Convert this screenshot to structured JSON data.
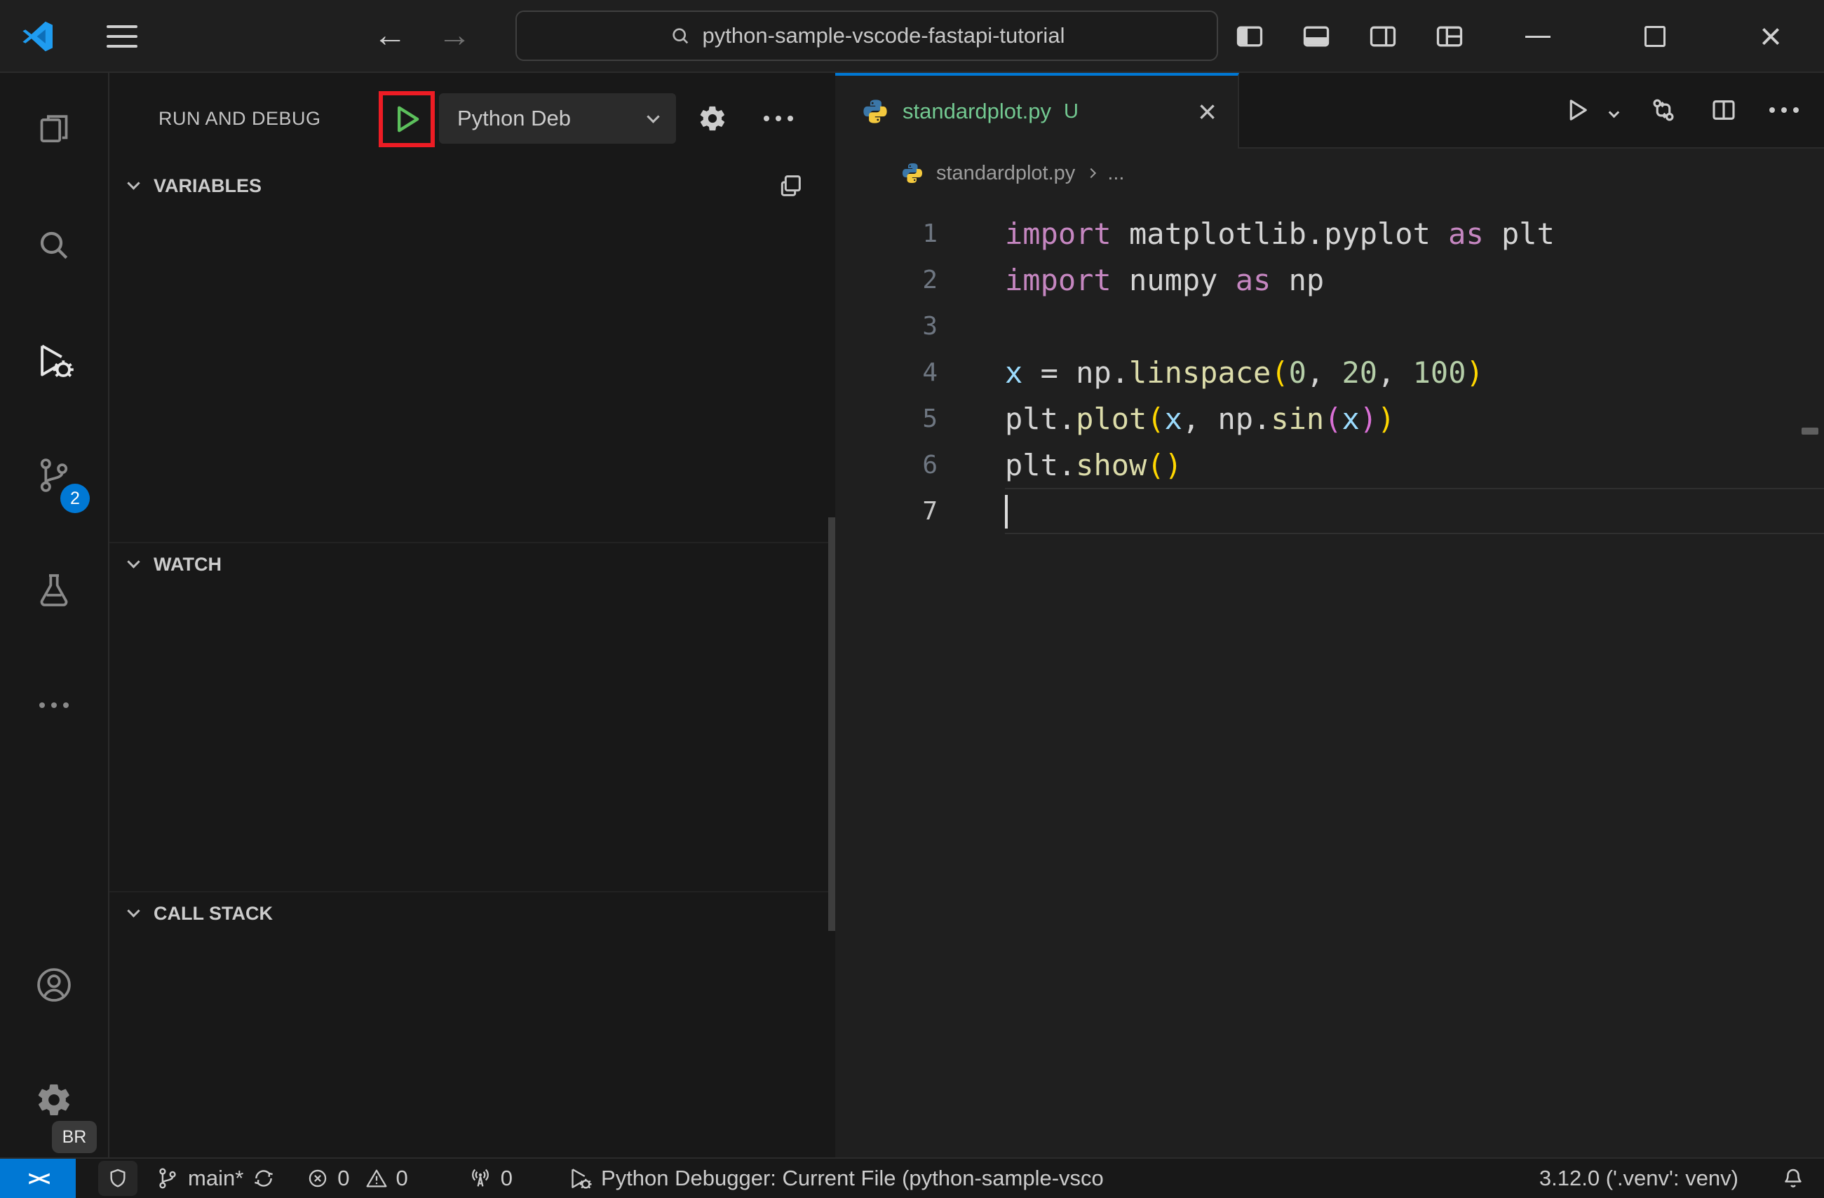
{
  "colors": {
    "accent": "#0078d4",
    "annotation-red": "#ed1c24",
    "debug-green": "#5cc05c",
    "untracked-green": "#73c991",
    "badge-blue": "#0078d4"
  },
  "glyphs": {
    "back_arrow": "←",
    "forward_arrow": "→",
    "close_x": "×"
  },
  "title_bar": {
    "search_value": "python-sample-vscode-fastapi-tutorial"
  },
  "activity_bar": {
    "source_control_badge": "2",
    "profile_badge": "BR"
  },
  "sidebar": {
    "title": "RUN AND DEBUG",
    "debug_config": "Python Deb",
    "sections": [
      {
        "label": "VARIABLES"
      },
      {
        "label": "WATCH"
      },
      {
        "label": "CALL STACK"
      }
    ]
  },
  "editor": {
    "tab": {
      "label": "standardplot.py",
      "git_status": "U"
    },
    "breadcrumb": {
      "file": "standardplot.py",
      "symbol": "..."
    },
    "lines": [
      {
        "num": "1",
        "tokens": [
          {
            "t": "import",
            "c": "kw"
          },
          {
            "t": " matplotlib.pyplot ",
            "c": "plain"
          },
          {
            "t": "as",
            "c": "kw"
          },
          {
            "t": " plt",
            "c": "plain"
          }
        ]
      },
      {
        "num": "2",
        "tokens": [
          {
            "t": "import",
            "c": "kw"
          },
          {
            "t": " numpy ",
            "c": "plain"
          },
          {
            "t": "as",
            "c": "kw"
          },
          {
            "t": " np",
            "c": "plain"
          }
        ]
      },
      {
        "num": "3",
        "tokens": []
      },
      {
        "num": "4",
        "tokens": [
          {
            "t": "x",
            "c": "var"
          },
          {
            "t": " = ",
            "c": "plain"
          },
          {
            "t": "np.",
            "c": "plain"
          },
          {
            "t": "linspace",
            "c": "fn"
          },
          {
            "t": "(",
            "c": "br1"
          },
          {
            "t": "0",
            "c": "num"
          },
          {
            "t": ", ",
            "c": "plain"
          },
          {
            "t": "20",
            "c": "num"
          },
          {
            "t": ", ",
            "c": "plain"
          },
          {
            "t": "100",
            "c": "num"
          },
          {
            "t": ")",
            "c": "br1"
          }
        ]
      },
      {
        "num": "5",
        "tokens": [
          {
            "t": "plt.",
            "c": "plain"
          },
          {
            "t": "plot",
            "c": "fn"
          },
          {
            "t": "(",
            "c": "br1"
          },
          {
            "t": "x",
            "c": "var"
          },
          {
            "t": ", ",
            "c": "plain"
          },
          {
            "t": "np.",
            "c": "plain"
          },
          {
            "t": "sin",
            "c": "fn"
          },
          {
            "t": "(",
            "c": "br2"
          },
          {
            "t": "x",
            "c": "var"
          },
          {
            "t": ")",
            "c": "br2"
          },
          {
            "t": ")",
            "c": "br1"
          }
        ]
      },
      {
        "num": "6",
        "tokens": [
          {
            "t": "plt.",
            "c": "plain"
          },
          {
            "t": "show",
            "c": "fn"
          },
          {
            "t": "(",
            "c": "br1"
          },
          {
            "t": ")",
            "c": "br1"
          }
        ]
      },
      {
        "num": "7",
        "tokens": [],
        "active": true,
        "cursor": true
      }
    ]
  },
  "status_bar": {
    "branch": "main*",
    "errors": "0",
    "warnings": "0",
    "ports": "0",
    "debug_status": "Python Debugger: Current File (python-sample-vsco",
    "python_version": "3.12.0 ('.venv': venv)"
  }
}
